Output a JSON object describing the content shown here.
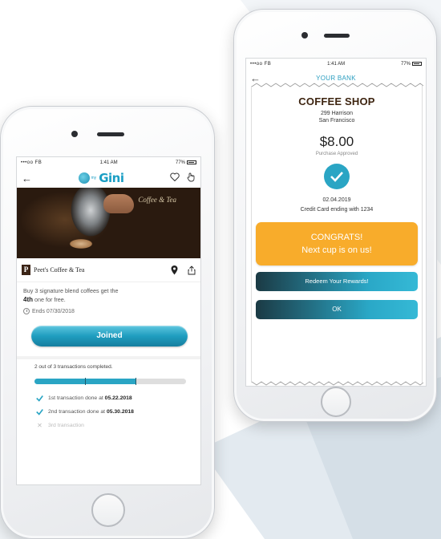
{
  "colors": {
    "brand_teal": "#2aa5c4",
    "accent_orange": "#f8ac2b",
    "coffee_brown": "#3d2410"
  },
  "left_phone": {
    "status": {
      "carrier": "•••oo FB",
      "time": "1:41 AM",
      "battery": "77%"
    },
    "nav": {
      "back_icon": "arrow-left-icon",
      "logo_text": "Gini",
      "logo_sub": "my",
      "favorite_icon": "heart-icon",
      "tap_icon": "hand-pointer-icon"
    },
    "photo": {
      "brand_text": "Coffee & Tea"
    },
    "merchant": {
      "logo_letter": "P",
      "name": "Peet's Coffee & Tea",
      "location_icon": "map-pin-icon",
      "share_icon": "share-icon"
    },
    "offer": {
      "line1": "Buy 3 signature blend coffees get the",
      "bold": "4th",
      "line2": " one for free."
    },
    "ends_text": "Ends 07/30/2018",
    "joined_button": "Joined",
    "progress": {
      "label": "2 out of 3 transactions completed.",
      "completed": 2,
      "total": 3
    },
    "transactions": [
      {
        "prefix": "1st transaction done at ",
        "date": "05.22.2018",
        "status": "done"
      },
      {
        "prefix": "2nd transaction done at ",
        "date": "05.30.2018",
        "status": "done"
      },
      {
        "prefix": "3rd transaction",
        "date": "",
        "status": "pending"
      }
    ]
  },
  "right_phone": {
    "status": {
      "carrier": "•••oo FB",
      "time": "1:41 AM",
      "battery": "77%"
    },
    "nav": {
      "back_icon": "arrow-left-icon",
      "title": "YOUR BANK"
    },
    "receipt": {
      "shop_name": "COFFEE SHOP",
      "address_line1": "299 Harrison",
      "address_line2": "San Francisco",
      "amount": "$8.00",
      "approved": "Purchase Approved",
      "check_icon": "check-circle-icon",
      "date": "02.04.2019",
      "card": "Credit Card ending with 1234"
    },
    "congrats_line1": "CONGRATS!",
    "congrats_line2": "Next cup is on us!",
    "redeem_button": "Redeem Your Rewards!",
    "ok_button": "OK"
  }
}
